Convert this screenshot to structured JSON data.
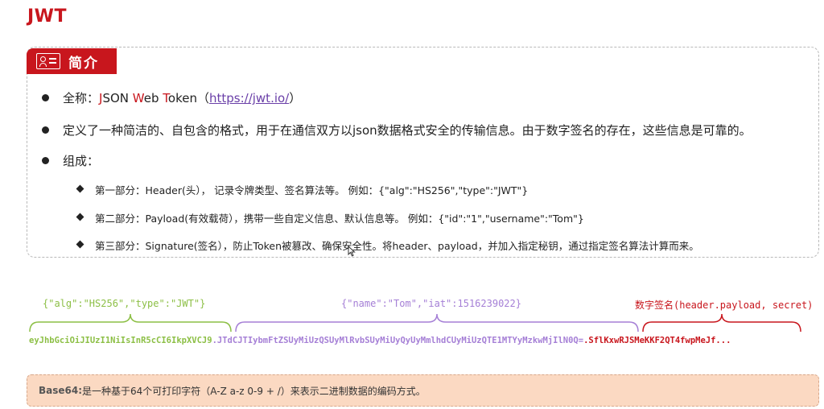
{
  "title": "JWT",
  "intro": {
    "tag_label": "简介",
    "items": [
      {
        "prefix": "全称：",
        "name_parts": [
          {
            "hl": "J",
            "rest": "SON "
          },
          {
            "hl": "W",
            "rest": "eb "
          },
          {
            "hl": "T",
            "rest": "oken"
          }
        ],
        "open": "（",
        "link": "https://jwt.io/",
        "close": "）"
      },
      {
        "text": "定义了一种简洁的、自包含的格式，用于在通信双方以json数据格式安全的传输信息。由于数字签名的存在，这些信息是可靠的。"
      },
      {
        "text": "组成："
      }
    ],
    "parts": [
      {
        "text": "第一部分：Header(头），  记录令牌类型、签名算法等。  例如：{\"alg\":\"HS256\",\"type\":\"JWT\"}"
      },
      {
        "text": "第二部分：Payload(有效载荷），携带一些自定义信息、默认信息等。  例如：{\"id\":\"1\",\"username\":\"Tom\"}"
      },
      {
        "text": "第三部分：Signature(签名），防止Token被篡改、确保安全性。将header、payload，并加入指定秘钥，通过指定签名算法计算而来。"
      }
    ]
  },
  "diagram": {
    "header_label": "{\"alg\":\"HS256\",\"type\":\"JWT\"}",
    "payload_label": "{\"name\":\"Tom\",\"iat\":1516239022}",
    "signature_label": "数字签名(header.payload, secret)",
    "token_header": "eyJhbGciOiJIUzI1NiIsInR5cCI6IkpXVCJ9",
    "dot": ".",
    "token_payload": "JTdCJTIybmFtZSUyMiUzQSUyMlRvbSUyMiUyQyUyMmlhdCUyMiUzQTE1MTYyMzkwMjIlN0Q=",
    "token_signature": "SflKxwRJSMeKKF2QT4fwpMeJf...",
    "colors": {
      "header": "#8cbf45",
      "payload": "#a57fd6",
      "signature": "#c8161d"
    }
  },
  "base64": {
    "label": "Base64:",
    "text": " 是一种基于64个可打印字符（A-Z a-z 0-9 + /）来表示二进制数据的编码方式。"
  }
}
